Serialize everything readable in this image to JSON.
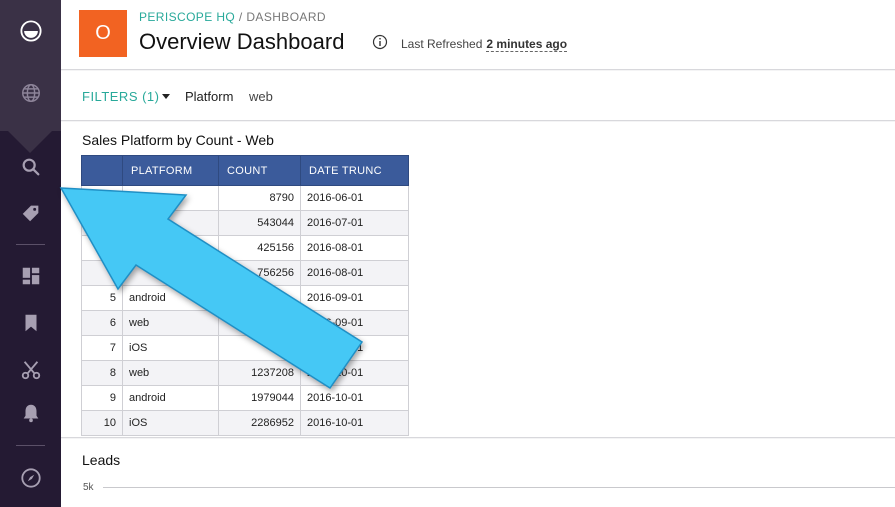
{
  "header": {
    "logo_letter": "O",
    "breadcrumb_org": "PERISCOPE HQ",
    "breadcrumb_sep": " / ",
    "breadcrumb_page": "DASHBOARD",
    "title": "Overview Dashboard",
    "last_refreshed_label": "Last Refreshed",
    "last_refreshed_value": "2 minutes ago"
  },
  "filters": {
    "label": "FILTERS (1)",
    "filter_name": "Platform",
    "filter_value": "web"
  },
  "widget1": {
    "title": "Sales Platform by Count - Web",
    "columns": [
      "",
      "PLATFORM",
      "COUNT",
      "DATE TRUNC"
    ],
    "rows": [
      [
        "1",
        "",
        "8790",
        "2016-06-01"
      ],
      [
        "2",
        "",
        "543044",
        "2016-07-01"
      ],
      [
        "3",
        "",
        "425156",
        "2016-08-01"
      ],
      [
        "4",
        "",
        "756256",
        "2016-08-01"
      ],
      [
        "5",
        "android",
        "",
        "2016-09-01"
      ],
      [
        "6",
        "web",
        "",
        "2016-09-01"
      ],
      [
        "7",
        "iOS",
        "",
        "2016-09-01"
      ],
      [
        "8",
        "web",
        "1237208",
        "2016-10-01"
      ],
      [
        "9",
        "android",
        "1979044",
        "2016-10-01"
      ],
      [
        "10",
        "iOS",
        "2286952",
        "2016-10-01"
      ]
    ]
  },
  "widget2": {
    "title": "Leads",
    "y_tick": "5k"
  },
  "colors": {
    "sidebar_bg": "#241a33",
    "accent_teal": "#28a99a",
    "logo_orange": "#f26322",
    "table_header": "#3b5b9b",
    "arrow": "#45c8f5"
  },
  "sidebar_icons": [
    "app-logo-icon",
    "globe-icon",
    "search-icon",
    "tag-icon",
    "dashboard-icon",
    "bookmark-icon",
    "scissors-icon",
    "bell-icon",
    "compass-icon"
  ]
}
